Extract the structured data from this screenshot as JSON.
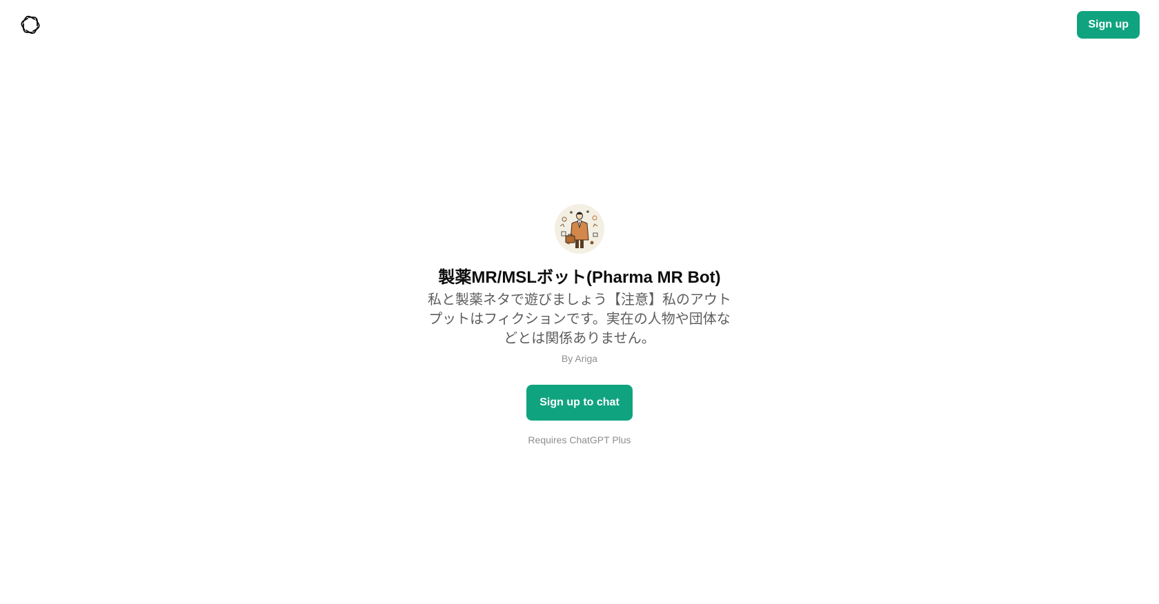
{
  "header": {
    "logo_icon": "openai-logo-icon",
    "signup_label": "Sign up"
  },
  "gpt": {
    "avatar_icon": "pharma-mr-avatar-image",
    "title": "製薬MR/MSLボット(Pharma MR Bot)",
    "description": "私と製薬ネタで遊びましょう【注意】私のアウトプットはフィクションです。実在の人物や団体などとは関係ありません。",
    "author": "By Ariga"
  },
  "cta": {
    "signup_chat_label": "Sign up to chat",
    "requires_note": "Requires ChatGPT Plus"
  },
  "colors": {
    "accent": "#10a37f",
    "text_primary": "#0d0d0d",
    "text_secondary": "#5d5d5d",
    "text_muted": "#8e8e8e"
  }
}
